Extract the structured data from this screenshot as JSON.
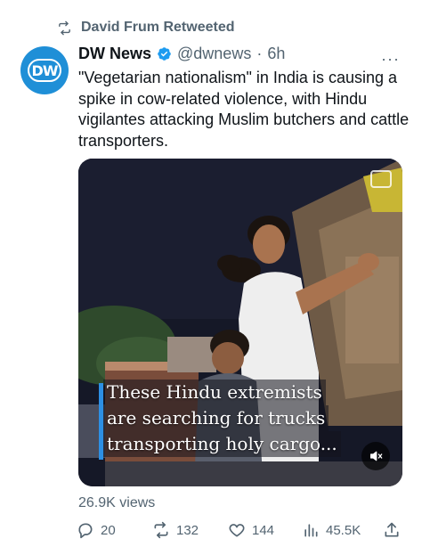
{
  "retweet": {
    "label": "David Frum Retweeted",
    "icon": "retweet-icon"
  },
  "author": {
    "avatar_text": "DW",
    "avatar_color": "#1f8fd7",
    "display_name": "DW News",
    "verified_color": "#1d9bf0",
    "handle": "@dwnews",
    "separator": "·",
    "time": "6h"
  },
  "tweet": {
    "text": "\"Vegetarian nationalism\" in India is causing a spike in cow-related violence, with Hindu vigilantes attacking Muslim butchers and cattle transporters."
  },
  "media": {
    "caption_lines": [
      "These Hindu extremists",
      "are searching for trucks",
      "transporting holy cargo..."
    ],
    "caption_accent": "#2d8fe3",
    "top_icon": "gif-icon",
    "mute_icon": "speaker-muted-icon"
  },
  "stats": {
    "views": "26.9K views"
  },
  "actions": {
    "replies": "20",
    "retweets": "132",
    "likes": "144",
    "analytics": "45.5K"
  }
}
